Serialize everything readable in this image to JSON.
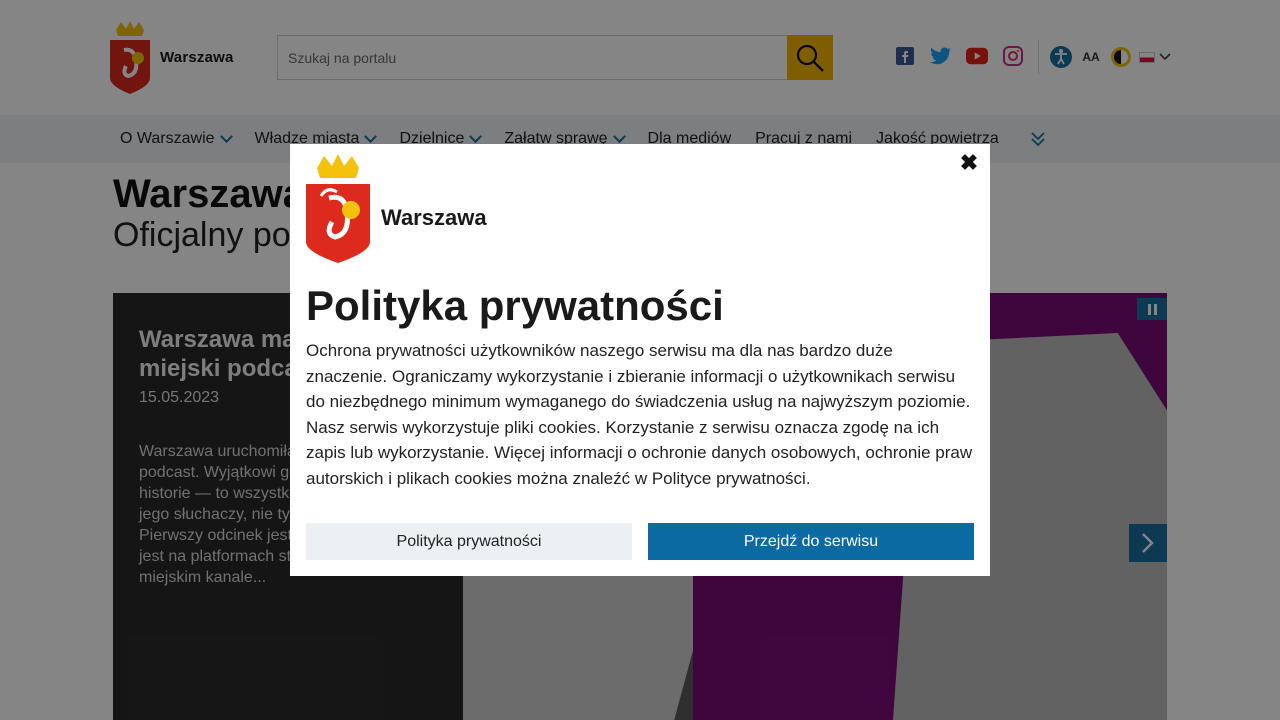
{
  "header": {
    "logo_text": "Warszawa",
    "search_placeholder": "Szukaj na portalu",
    "social_icons": [
      "facebook-icon",
      "twitter-icon",
      "youtube-icon",
      "instagram-icon"
    ],
    "tools": {
      "accessibility_icon": "accessibility-icon",
      "font_size_label": "AA",
      "contrast_icon": "contrast-icon",
      "language_flag": "pl"
    }
  },
  "nav": {
    "items": [
      {
        "label": "O Warszawie",
        "dropdown": true
      },
      {
        "label": "Władze miasta",
        "dropdown": true
      },
      {
        "label": "Dzielnice",
        "dropdown": true
      },
      {
        "label": "Załatw sprawę",
        "dropdown": true
      },
      {
        "label": "Dla mediów",
        "dropdown": false
      },
      {
        "label": "Pracuj z nami",
        "dropdown": false
      },
      {
        "label": "Jakość powietrza",
        "dropdown": false
      }
    ]
  },
  "page": {
    "title": "Warszawa",
    "subtitle": "Oficjalny portal"
  },
  "slide": {
    "title": "Warszawa ma swój miejski podcast",
    "date": "15.05.2023",
    "description": "Warszawa uruchomiła swój miejski podcast. Wyjątkowi goście i wyjątkowe historie — to wszystko dla wszystkich jego słuchaczy, nie tylko tych ze stolicy. Pierwszy odcinek jest już dziś dostępny jest na platformach streamingowych i miejskim kanale..."
  },
  "modal": {
    "logo_text": "Warszawa",
    "title": "Polityka prywatności",
    "body": "Ochrona prywatności użytkowników naszego serwisu ma dla nas bardzo duże znaczenie. Ograniczamy wykorzystanie i zbieranie informacji o użytkownikach serwisu do niezbędnego minimum wymaganego do świadczenia usług na najwyższym poziomie. Nasz serwis wykorzystuje pliki cookies. Korzystanie z serwisu oznacza zgodę na ich zapis lub wykorzystanie. Więcej informacji o ochronie danych osobowych, ochronie praw autorskich i plikach cookies można znaleźć w Polityce prywatności.",
    "secondary_button": "Polityka prywatności",
    "primary_button": "Przejdź do serwisu",
    "close_symbol": "✖"
  },
  "colors": {
    "accent": "#0b6aa2",
    "search_button": "#f4b400",
    "slide_purple": "#7a0d76"
  }
}
